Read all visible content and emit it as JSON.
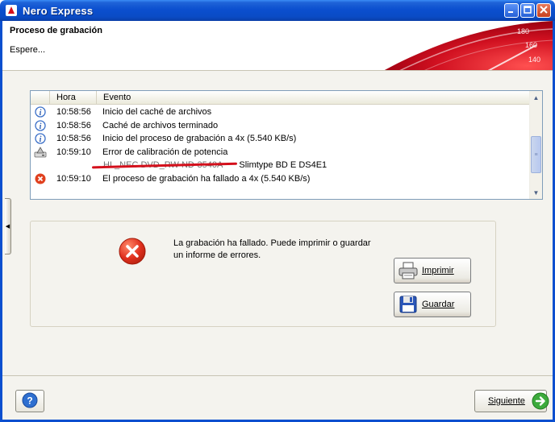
{
  "window": {
    "title": "Nero Express",
    "controls": [
      "minimize-icon",
      "maximize-icon",
      "close-icon"
    ]
  },
  "header": {
    "title": "Proceso de grabación",
    "subtitle": "Espere...",
    "gauge_numbers": [
      "180",
      "160",
      "140"
    ]
  },
  "log": {
    "columns": [
      "Hora",
      "Evento"
    ],
    "rows": [
      {
        "icon": "info-icon",
        "time": "10:58:56",
        "event": "Inicio del caché de archivos"
      },
      {
        "icon": "info-icon",
        "time": "10:58:56",
        "event": "Caché de archivos terminado"
      },
      {
        "icon": "info-icon",
        "time": "10:58:56",
        "event": "Inicio del proceso de grabación a 4x (5.540 KB/s)"
      },
      {
        "icon": "warning-drive-icon",
        "time": "10:59:10",
        "event": "Error de calibración de potencia"
      }
    ],
    "drive_row": {
      "struck_text": "HL_NEC DVD_RW ND-3540A",
      "replacement_text": "Slimtype BD E DS4E1"
    },
    "final_row": {
      "icon": "error-icon",
      "time": "10:59:10",
      "event": "El proceso de grabación ha fallado a 4x (5.540 KB/s)"
    }
  },
  "message": {
    "line1": "La grabación ha fallado. Puede imprimir o guardar",
    "line2": "un informe de errores."
  },
  "buttons": {
    "print": "Imprimir",
    "save": "Guardar",
    "next": "Siguiente",
    "help": "?"
  },
  "colors": {
    "titlebar": "#0b4fcf",
    "error": "#e0301e",
    "strike": "#d4101c",
    "accent_red": "#cc1020"
  }
}
